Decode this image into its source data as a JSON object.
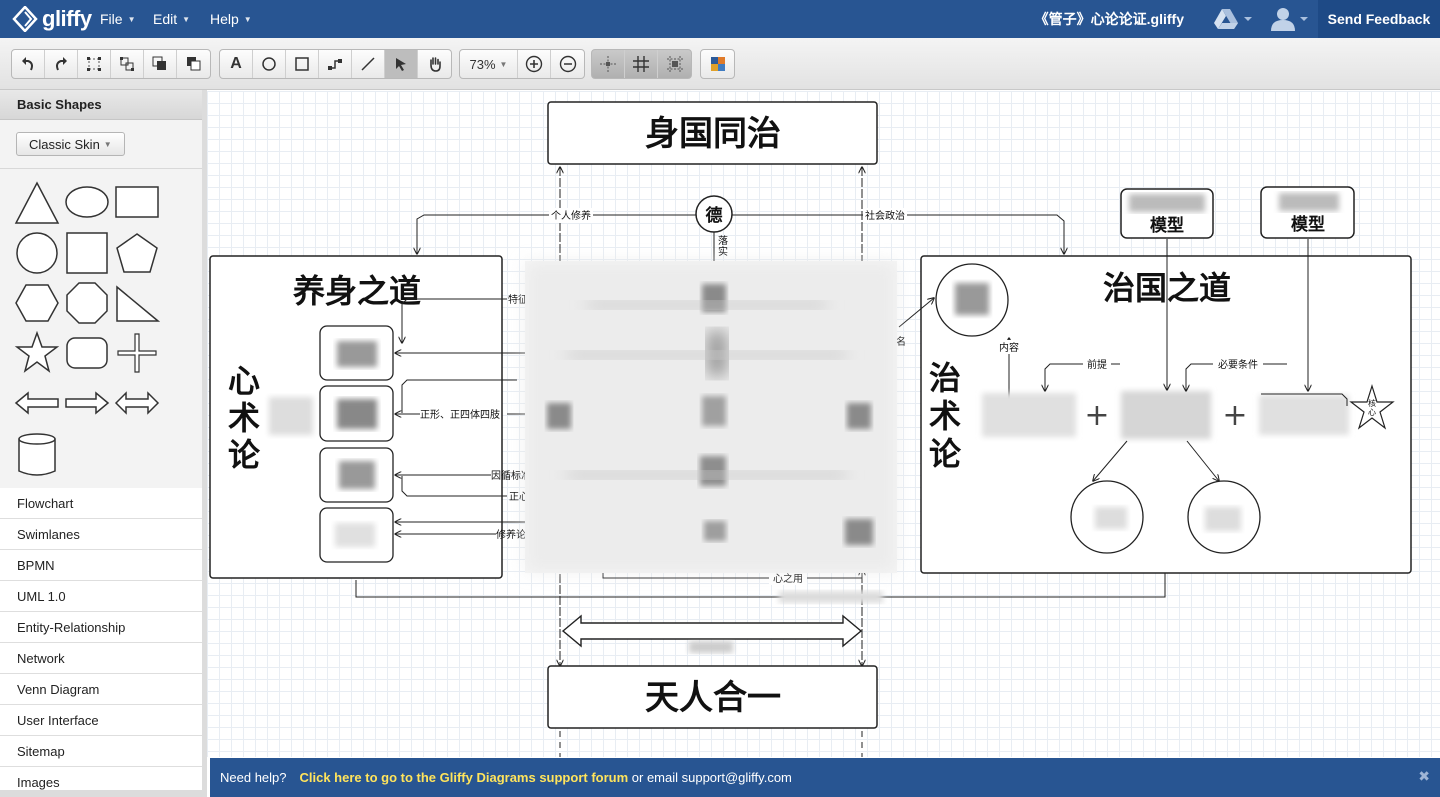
{
  "app": {
    "logo_text": "gliffy",
    "doc_title": "《管子》心论论证.gliffy",
    "send_feedback": "Send Feedback"
  },
  "menu": {
    "file": "File",
    "edit": "Edit",
    "help": "Help"
  },
  "toolbar": {
    "zoom": "73%"
  },
  "sidebar": {
    "header": "Basic Shapes",
    "skin": "Classic Skin",
    "libraries": [
      "Flowchart",
      "Swimlanes",
      "BPMN",
      "UML 1.0",
      "Entity-Relationship",
      "Network",
      "Venn Diagram",
      "User Interface",
      "Sitemap",
      "Images"
    ]
  },
  "diagram": {
    "top_title": "身国同治",
    "bottom_title": "天人合一",
    "de": "德",
    "luoshi": "落实",
    "personal_cultivation": "个人修养",
    "social_politics": "社会政治",
    "left_box_title": "养身之道",
    "left_vertical": "心术论",
    "right_box_title": "治国之道",
    "right_vertical": "治术论",
    "model1": "模型",
    "model2": "模型",
    "tezheng": "特征",
    "zhengxing": "正形、正四体四肢",
    "yinxun": "因循标准",
    "zhengxin": "正心",
    "xiuyang": "修养论",
    "xinzhiyong": "心之用",
    "ming": "名",
    "neirong": "内容",
    "qianti": "前提",
    "biyao": "必要条件",
    "hexin": "核心"
  },
  "helpbar": {
    "prefix": "Need help?",
    "link": "Click here to go to the Gliffy Diagrams support forum",
    "suffix": " or email support@gliffy.com",
    "close": "✖"
  }
}
